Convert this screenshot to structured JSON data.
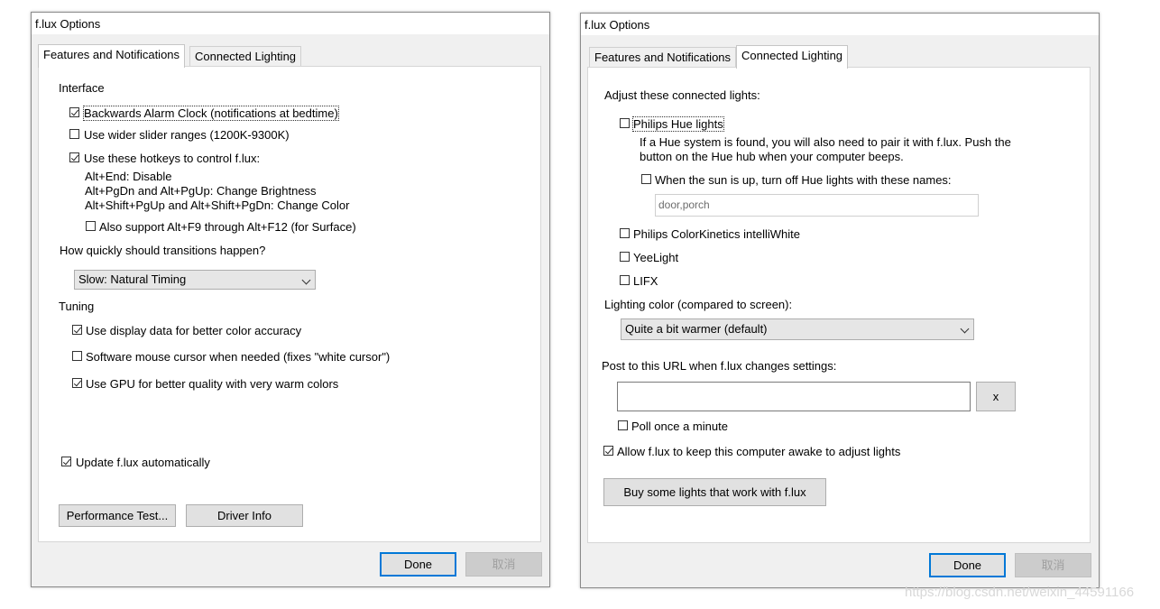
{
  "left": {
    "title": "f.lux Options",
    "tabs": [
      "Features and Notifications",
      "Connected Lighting"
    ],
    "interface_heading": "Interface",
    "opt_alarm": {
      "label": "Backwards Alarm Clock (notifications at bedtime)",
      "checked": true
    },
    "opt_wider": {
      "label": "Use wider slider ranges (1200K-9300K)",
      "checked": false
    },
    "opt_hotkeys": {
      "label": "Use these hotkeys to control f.lux:",
      "checked": true
    },
    "hotkey_lines": [
      "Alt+End: Disable",
      "Alt+PgDn and Alt+PgUp: Change Brightness",
      "Alt+Shift+PgUp and Alt+Shift+PgDn: Change Color"
    ],
    "opt_surface": {
      "label": "Also support Alt+F9 through Alt+F12 (for Surface)",
      "checked": false
    },
    "transitions_question": "How quickly should transitions happen?",
    "transition_select": "Slow: Natural Timing",
    "tuning_heading": "Tuning",
    "opt_display": {
      "label": "Use display data for better color accuracy",
      "checked": true
    },
    "opt_cursor": {
      "label": "Software mouse cursor when needed (fixes \"white cursor\")",
      "checked": false
    },
    "opt_gpu": {
      "label": "Use GPU for better quality with very warm colors",
      "checked": true
    },
    "opt_update": {
      "label": "Update f.lux automatically",
      "checked": true
    },
    "perf_button": "Performance Test...",
    "driver_button": "Driver Info",
    "done_button": "Done",
    "cancel_button": "取消"
  },
  "right": {
    "title": "f.lux Options",
    "tabs": [
      "Features and Notifications",
      "Connected Lighting"
    ],
    "adjust_heading": "Adjust these connected lights:",
    "opt_hue": {
      "label": "Philips Hue lights",
      "checked": false
    },
    "hue_info": [
      "If a Hue system is found, you will also need to pair it with f.lux. Push the",
      "button on the Hue hub when your computer beeps."
    ],
    "opt_sunup": {
      "label": "When the sun is up, turn off Hue lights with these names:",
      "checked": false
    },
    "hue_names_value": "door,porch",
    "opt_colorkinetics": {
      "label": "Philips ColorKinetics intelliWhite",
      "checked": false
    },
    "opt_yeelight": {
      "label": "YeeLight",
      "checked": false
    },
    "opt_lifx": {
      "label": "LIFX",
      "checked": false
    },
    "lighting_color_label": "Lighting color (compared to screen):",
    "lighting_color_select": "Quite a bit warmer (default)",
    "post_url_label": "Post to this URL when f.lux changes settings:",
    "url_value": "",
    "clear_button": "x",
    "opt_poll": {
      "label": "Poll once a minute",
      "checked": false
    },
    "opt_awake": {
      "label": "Allow f.lux to keep this computer awake to adjust lights",
      "checked": true
    },
    "buy_button": "Buy some lights that work with f.lux",
    "done_button": "Done",
    "cancel_button": "取消"
  },
  "watermark": "https://blog.csdn.net/weixin_44591166"
}
